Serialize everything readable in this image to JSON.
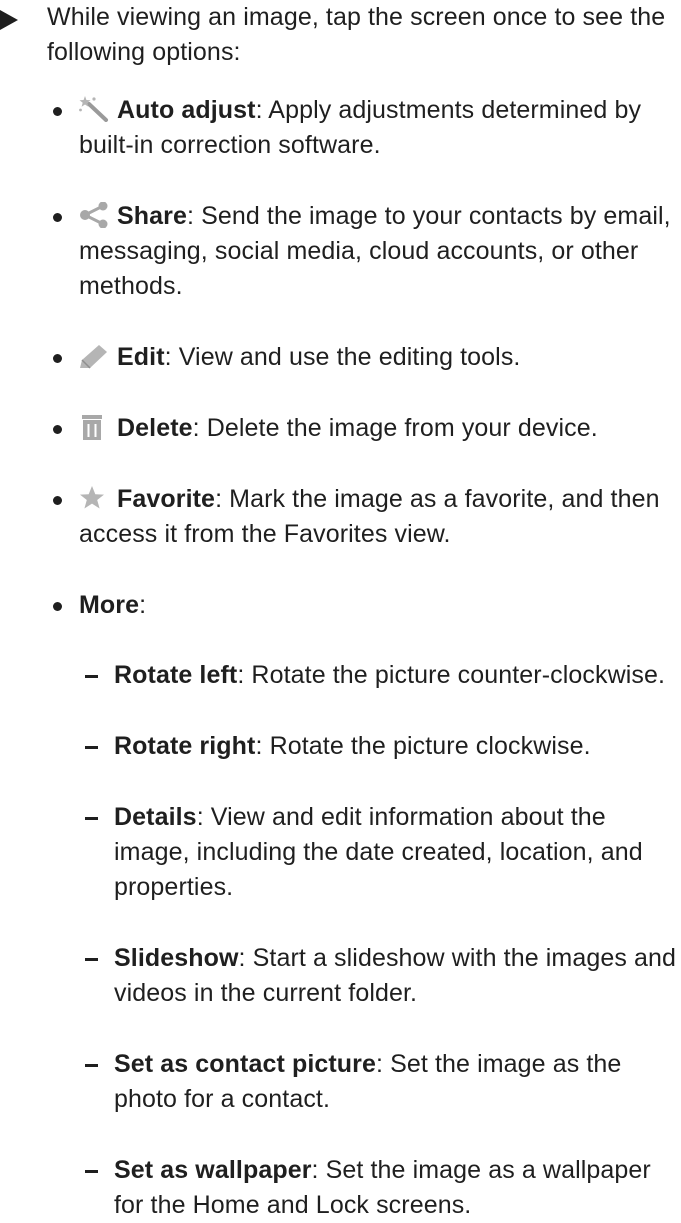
{
  "intro": {
    "text": "While viewing an image, tap the screen once to see the following options:"
  },
  "options": [
    {
      "icon": "auto-adjust-icon",
      "term": "Auto adjust",
      "desc": ": Apply adjustments determined by built-in correction software."
    },
    {
      "icon": "share-icon",
      "term": "Share",
      "desc": ": Send the image to your contacts by email, messaging, social media, cloud accounts, or other methods."
    },
    {
      "icon": "edit-icon",
      "term": "Edit",
      "desc": ": View and use the editing tools."
    },
    {
      "icon": "delete-icon",
      "term": "Delete",
      "desc": ": Delete the image from your device."
    },
    {
      "icon": "favorite-icon",
      "term": "Favorite",
      "desc": ": Mark the image as a favorite, and then access it from the Favorites view."
    },
    {
      "icon": "",
      "term": "More",
      "desc": ":"
    }
  ],
  "more_items": [
    {
      "term": "Rotate left",
      "desc": ": Rotate the picture counter-clockwise."
    },
    {
      "term": "Rotate right",
      "desc": ": Rotate the picture clockwise."
    },
    {
      "term": "Details",
      "desc": ": View and edit information about the image, including the date created, location, and properties."
    },
    {
      "term": "Slideshow",
      "desc": ": Start a slideshow with the images and videos in the current folder."
    },
    {
      "term": "Set as contact picture",
      "desc": ": Set the image as the photo for a contact."
    },
    {
      "term": "Set as wallpaper",
      "desc": ": Set the image as a wallpaper for the Home and Lock screens."
    }
  ],
  "colors": {
    "text": "#1f1f1f",
    "icon_grey": "#b5b5b5",
    "icon_dark": "#8f8f8f"
  }
}
